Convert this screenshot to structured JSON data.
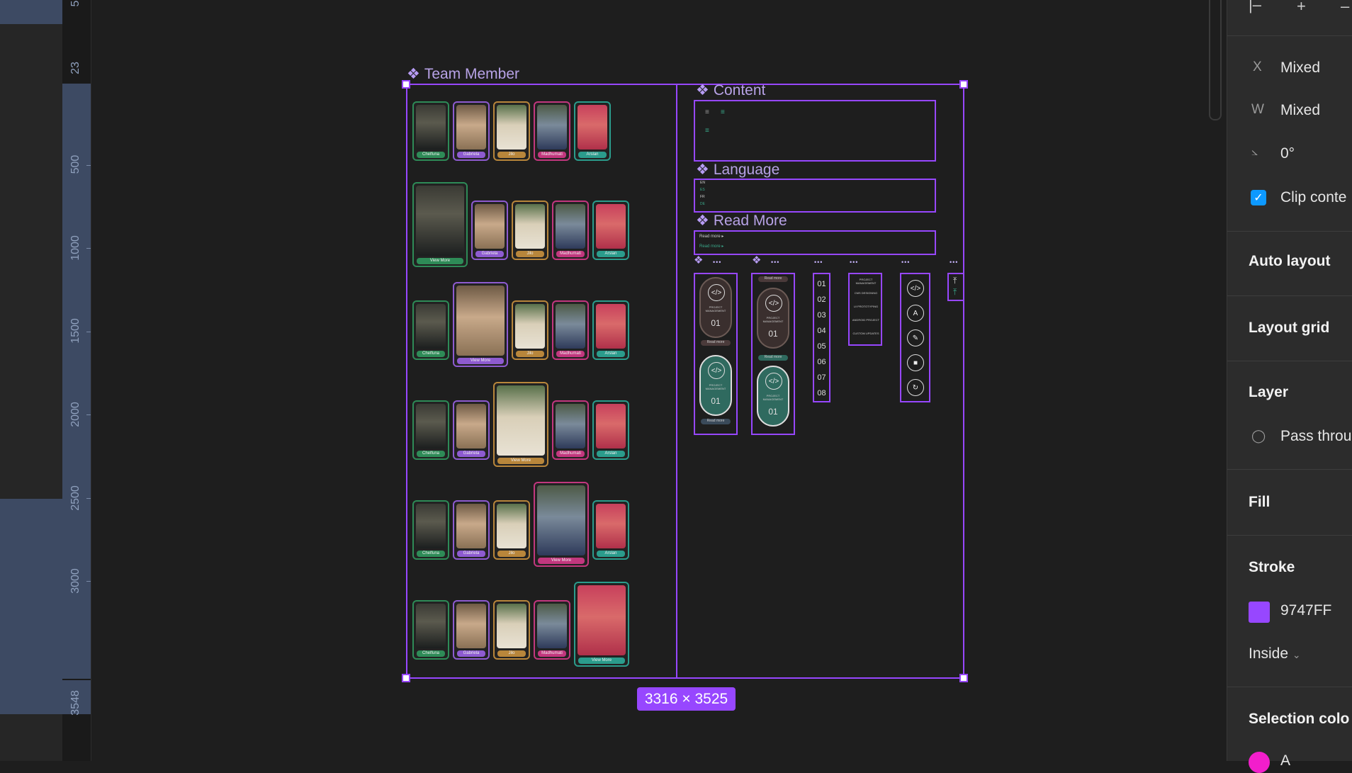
{
  "ruler": {
    "marks": [
      "5",
      "23",
      "500",
      "1000",
      "1500",
      "2000",
      "2500",
      "3000",
      "3548"
    ]
  },
  "frame": {
    "team_title": "Team Member",
    "size_label": "3316 × 3525",
    "stroke_color": "#9747FF"
  },
  "team": {
    "rows": [
      {
        "highlight": -1,
        "members": [
          "Chelfuna",
          "Gabriela",
          "Jilo",
          "Madhumati",
          "Arslan"
        ]
      },
      {
        "highlight": 0,
        "members": [
          "View More",
          "Gabriela",
          "Jilo",
          "Madhumati",
          "Arslan"
        ]
      },
      {
        "highlight": 1,
        "members": [
          "Chelfuna",
          "View More",
          "Jilo",
          "Madhumati",
          "Arslan"
        ]
      },
      {
        "highlight": 2,
        "members": [
          "Chelfuna",
          "Gabriela",
          "View More",
          "Madhumati",
          "Arslan"
        ]
      },
      {
        "highlight": 3,
        "members": [
          "Chelfuna",
          "Gabriela",
          "Jilo",
          "View More",
          "Arslan"
        ]
      },
      {
        "highlight": 4,
        "members": [
          "Chelfuna",
          "Gabriela",
          "Jilo",
          "Madhumati",
          "View More"
        ]
      }
    ]
  },
  "components": {
    "content_title": "Content",
    "language_title": "Language",
    "language_items": [
      "EN",
      "ES",
      "FR",
      "DE"
    ],
    "readmore_title": "Read More",
    "readmore_items": [
      "Read more ▸",
      "Read more ▸"
    ],
    "card_label": "PROJECT MANAGEMENT",
    "card_number": "01",
    "card_button": "Read more",
    "numbers": [
      "01",
      "02",
      "03",
      "04",
      "05",
      "06",
      "07",
      "08"
    ],
    "text_list": [
      "PROJECT MANAGEMENT",
      "CMS DESIGNING",
      "UI PROTOTYPING",
      "ANDROID PROJECT",
      "CUSTOM UPDATES"
    ],
    "dots": "•••"
  },
  "panel": {
    "x_label": "X",
    "x_value": "Mixed",
    "w_label": "W",
    "w_value": "Mixed",
    "angle_label": "⦣",
    "angle_value": "0°",
    "clip_label": "Clip conte",
    "auto_layout": "Auto layout",
    "layout_grid": "Layout grid",
    "layer": "Layer",
    "blend_value": "Pass throu",
    "fill": "Fill",
    "stroke": "Stroke",
    "stroke_hex": "9747FF",
    "stroke_align": "Inside",
    "selection_colors": "Selection colo",
    "selection_hex": "A"
  }
}
